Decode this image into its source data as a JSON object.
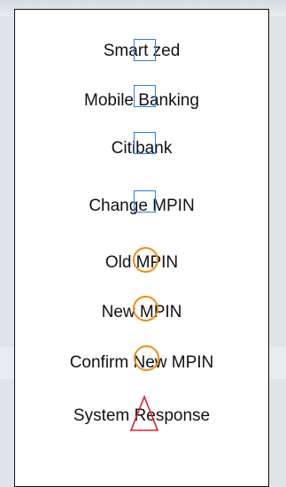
{
  "steps": [
    {
      "label": "Smart zed",
      "marker": "square"
    },
    {
      "label": "Mobile Banking",
      "marker": "square"
    },
    {
      "label": "Citibank",
      "marker": "square"
    },
    {
      "label": "Change MPIN",
      "marker": "square"
    },
    {
      "label": "Old MPIN",
      "marker": "circle"
    },
    {
      "label": "New MPIN",
      "marker": "circle"
    },
    {
      "label": "Confirm New MPIN",
      "marker": "circle"
    },
    {
      "label": "System Response",
      "marker": "triangle"
    }
  ],
  "colors": {
    "square_marker": "#2a7de1",
    "circle_marker": "#ef8c16",
    "triangle_marker": "#e0202a",
    "panel_border": "#111111",
    "panel_background": "#ffffff"
  }
}
